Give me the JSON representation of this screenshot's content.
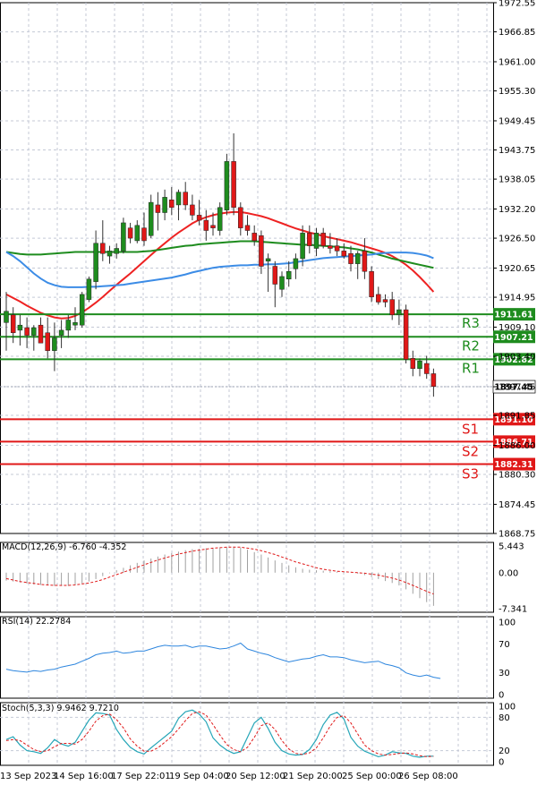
{
  "chart_data": {
    "type": "candlestick",
    "price_axis": {
      "ylim": [
        1868.75,
        1972.55
      ],
      "ticks": [
        "1972.55",
        "1966.85",
        "1961.00",
        "1955.30",
        "1949.45",
        "1943.75",
        "1938.05",
        "1932.20",
        "1926.50",
        "1920.65",
        "1914.95",
        "1909.10",
        "1903.40",
        "1897.45",
        "1891.85",
        "1886.00",
        "1880.30",
        "1874.45",
        "1868.75"
      ]
    },
    "x_labels": [
      "13 Sep 2023",
      "14 Sep 16:00",
      "17 Sep 22:01",
      "19 Sep 04:00",
      "20 Sep 12:00",
      "21 Sep 20:00",
      "25 Sep 00:00",
      "26 Sep 08:00"
    ],
    "candles": [
      {
        "o": 1910.0,
        "h": 1916.0,
        "l": 1904.5,
        "c": 1912.2
      },
      {
        "o": 1911.5,
        "h": 1913.0,
        "l": 1906.0,
        "c": 1908.0
      },
      {
        "o": 1908.5,
        "h": 1911.5,
        "l": 1905.5,
        "c": 1909.5
      },
      {
        "o": 1909.0,
        "h": 1911.0,
        "l": 1905.0,
        "c": 1907.5
      },
      {
        "o": 1907.5,
        "h": 1909.5,
        "l": 1904.5,
        "c": 1909.0
      },
      {
        "o": 1909.5,
        "h": 1911.0,
        "l": 1906.0,
        "c": 1906.0
      },
      {
        "o": 1908.0,
        "h": 1911.0,
        "l": 1903.0,
        "c": 1904.5
      },
      {
        "o": 1904.5,
        "h": 1910.0,
        "l": 1900.5,
        "c": 1907.0
      },
      {
        "o": 1907.5,
        "h": 1910.5,
        "l": 1905.0,
        "c": 1908.5
      },
      {
        "o": 1908.5,
        "h": 1911.5,
        "l": 1907.0,
        "c": 1910.5
      },
      {
        "o": 1909.5,
        "h": 1913.0,
        "l": 1908.5,
        "c": 1910.0
      },
      {
        "o": 1909.5,
        "h": 1916.0,
        "l": 1909.0,
        "c": 1915.5
      },
      {
        "o": 1914.5,
        "h": 1919.0,
        "l": 1914.0,
        "c": 1918.5
      },
      {
        "o": 1918.0,
        "h": 1928.0,
        "l": 1916.5,
        "c": 1925.5
      },
      {
        "o": 1925.5,
        "h": 1930.0,
        "l": 1922.0,
        "c": 1923.5
      },
      {
        "o": 1923.0,
        "h": 1925.0,
        "l": 1921.5,
        "c": 1924.0
      },
      {
        "o": 1923.5,
        "h": 1925.5,
        "l": 1922.5,
        "c": 1924.5
      },
      {
        "o": 1924.0,
        "h": 1930.5,
        "l": 1923.5,
        "c": 1929.5
      },
      {
        "o": 1928.5,
        "h": 1929.5,
        "l": 1925.5,
        "c": 1926.5
      },
      {
        "o": 1926.0,
        "h": 1930.0,
        "l": 1925.5,
        "c": 1929.0
      },
      {
        "o": 1928.5,
        "h": 1931.5,
        "l": 1925.0,
        "c": 1926.0
      },
      {
        "o": 1927.0,
        "h": 1935.0,
        "l": 1926.5,
        "c": 1933.5
      },
      {
        "o": 1933.0,
        "h": 1935.5,
        "l": 1928.0,
        "c": 1931.5
      },
      {
        "o": 1931.5,
        "h": 1936.0,
        "l": 1930.0,
        "c": 1934.5
      },
      {
        "o": 1934.0,
        "h": 1936.5,
        "l": 1931.0,
        "c": 1932.5
      },
      {
        "o": 1933.0,
        "h": 1936.0,
        "l": 1930.0,
        "c": 1935.5
      },
      {
        "o": 1935.5,
        "h": 1937.5,
        "l": 1932.0,
        "c": 1933.0
      },
      {
        "o": 1933.0,
        "h": 1935.0,
        "l": 1930.0,
        "c": 1931.0
      },
      {
        "o": 1931.0,
        "h": 1934.0,
        "l": 1929.0,
        "c": 1930.0
      },
      {
        "o": 1930.0,
        "h": 1932.0,
        "l": 1926.0,
        "c": 1928.0
      },
      {
        "o": 1929.0,
        "h": 1931.5,
        "l": 1927.0,
        "c": 1928.5
      },
      {
        "o": 1928.0,
        "h": 1933.5,
        "l": 1927.0,
        "c": 1932.5
      },
      {
        "o": 1932.0,
        "h": 1943.0,
        "l": 1931.0,
        "c": 1941.5
      },
      {
        "o": 1941.5,
        "h": 1947.0,
        "l": 1931.0,
        "c": 1932.5
      },
      {
        "o": 1932.5,
        "h": 1933.5,
        "l": 1927.0,
        "c": 1928.5
      },
      {
        "o": 1929.0,
        "h": 1931.0,
        "l": 1927.0,
        "c": 1928.0
      },
      {
        "o": 1927.5,
        "h": 1929.0,
        "l": 1925.0,
        "c": 1926.0
      },
      {
        "o": 1927.0,
        "h": 1928.0,
        "l": 1919.5,
        "c": 1921.0
      },
      {
        "o": 1922.0,
        "h": 1923.5,
        "l": 1916.0,
        "c": 1922.5
      },
      {
        "o": 1921.0,
        "h": 1922.0,
        "l": 1913.0,
        "c": 1917.5
      },
      {
        "o": 1916.5,
        "h": 1920.0,
        "l": 1915.0,
        "c": 1919.0
      },
      {
        "o": 1918.5,
        "h": 1922.0,
        "l": 1917.0,
        "c": 1920.0
      },
      {
        "o": 1920.5,
        "h": 1923.5,
        "l": 1918.5,
        "c": 1922.5
      },
      {
        "o": 1922.5,
        "h": 1929.0,
        "l": 1921.0,
        "c": 1927.5
      },
      {
        "o": 1927.5,
        "h": 1929.0,
        "l": 1923.5,
        "c": 1925.0
      },
      {
        "o": 1924.5,
        "h": 1928.5,
        "l": 1923.0,
        "c": 1927.5
      },
      {
        "o": 1927.5,
        "h": 1928.5,
        "l": 1924.5,
        "c": 1925.0
      },
      {
        "o": 1925.0,
        "h": 1927.5,
        "l": 1923.5,
        "c": 1924.5
      },
      {
        "o": 1925.0,
        "h": 1926.5,
        "l": 1923.0,
        "c": 1924.0
      },
      {
        "o": 1924.0,
        "h": 1925.5,
        "l": 1922.5,
        "c": 1923.0
      },
      {
        "o": 1923.5,
        "h": 1925.0,
        "l": 1920.0,
        "c": 1921.5
      },
      {
        "o": 1921.5,
        "h": 1924.0,
        "l": 1918.5,
        "c": 1923.5
      },
      {
        "o": 1924.0,
        "h": 1926.5,
        "l": 1918.5,
        "c": 1920.0
      },
      {
        "o": 1920.0,
        "h": 1921.0,
        "l": 1914.0,
        "c": 1915.0
      },
      {
        "o": 1915.5,
        "h": 1917.0,
        "l": 1913.5,
        "c": 1914.0
      },
      {
        "o": 1914.5,
        "h": 1915.5,
        "l": 1913.0,
        "c": 1914.0
      },
      {
        "o": 1914.5,
        "h": 1916.0,
        "l": 1910.5,
        "c": 1911.5
      },
      {
        "o": 1911.5,
        "h": 1914.5,
        "l": 1909.5,
        "c": 1912.5
      },
      {
        "o": 1912.5,
        "h": 1913.5,
        "l": 1902.0,
        "c": 1902.8
      },
      {
        "o": 1903.0,
        "h": 1904.5,
        "l": 1899.5,
        "c": 1901.0
      },
      {
        "o": 1901.0,
        "h": 1903.0,
        "l": 1899.5,
        "c": 1902.5
      },
      {
        "o": 1902.0,
        "h": 1903.5,
        "l": 1899.0,
        "c": 1900.0
      },
      {
        "o": 1900.0,
        "h": 1901.0,
        "l": 1895.5,
        "c": 1897.5
      }
    ],
    "series": [
      {
        "name": "",
        "color": "#ee2222",
        "values": [
          1915.5,
          1914.8,
          1914.1,
          1913.3,
          1912.6,
          1911.9,
          1911.4,
          1911.0,
          1910.8,
          1910.9,
          1911.3,
          1912.0,
          1912.9,
          1913.9,
          1915.0,
          1916.2,
          1917.4,
          1918.5,
          1919.6,
          1920.8,
          1922.0,
          1923.2,
          1924.4,
          1925.5,
          1926.6,
          1927.6,
          1928.5,
          1929.4,
          1930.1,
          1930.6,
          1931.0,
          1931.3,
          1931.5,
          1931.6,
          1931.6,
          1931.4,
          1931.1,
          1930.8,
          1930.4,
          1929.9,
          1929.4,
          1928.9,
          1928.4,
          1928.0,
          1927.6,
          1927.3,
          1926.9,
          1926.6,
          1926.3,
          1926.0,
          1925.7,
          1925.3,
          1924.9,
          1924.5,
          1924.1,
          1923.6,
          1923.0,
          1922.2,
          1921.3,
          1920.2,
          1918.9,
          1917.5,
          1916.0
        ]
      },
      {
        "name": "",
        "color": "#1e8c1e",
        "values": [
          1923.8,
          1923.6,
          1923.4,
          1923.3,
          1923.3,
          1923.3,
          1923.4,
          1923.5,
          1923.6,
          1923.7,
          1923.8,
          1923.8,
          1923.8,
          1923.8,
          1923.8,
          1923.8,
          1923.8,
          1923.8,
          1923.8,
          1923.8,
          1923.9,
          1924.0,
          1924.2,
          1924.4,
          1924.6,
          1924.8,
          1925.0,
          1925.1,
          1925.3,
          1925.4,
          1925.5,
          1925.6,
          1925.7,
          1925.8,
          1925.9,
          1925.9,
          1925.9,
          1925.8,
          1925.7,
          1925.6,
          1925.5,
          1925.4,
          1925.3,
          1925.2,
          1925.2,
          1925.1,
          1925.0,
          1924.9,
          1924.8,
          1924.7,
          1924.5,
          1924.3,
          1924.0,
          1923.7,
          1923.3,
          1922.9,
          1922.5,
          1922.2,
          1921.9,
          1921.6,
          1921.3,
          1921.0,
          1920.7
        ]
      },
      {
        "name": "",
        "color": "#3c8ce6",
        "values": [
          1923.8,
          1923.0,
          1922.0,
          1920.8,
          1919.6,
          1918.6,
          1917.8,
          1917.3,
          1917.0,
          1916.9,
          1916.9,
          1916.9,
          1917.0,
          1917.0,
          1917.1,
          1917.2,
          1917.3,
          1917.4,
          1917.6,
          1917.8,
          1918.0,
          1918.2,
          1918.4,
          1918.6,
          1918.8,
          1919.1,
          1919.4,
          1919.8,
          1920.1,
          1920.4,
          1920.7,
          1920.9,
          1921.0,
          1921.1,
          1921.2,
          1921.2,
          1921.3,
          1921.3,
          1921.4,
          1921.4,
          1921.5,
          1921.6,
          1921.8,
          1922.0,
          1922.2,
          1922.4,
          1922.6,
          1922.7,
          1922.8,
          1922.9,
          1923.0,
          1923.1,
          1923.2,
          1923.3,
          1923.5,
          1923.6,
          1923.7,
          1923.7,
          1923.7,
          1923.6,
          1923.4,
          1923.1,
          1922.6
        ]
      }
    ],
    "levels": [
      {
        "name": "R3",
        "value": 1911.61,
        "label": "1911.61",
        "color": "#1e8c1e"
      },
      {
        "name": "R2",
        "value": 1907.21,
        "label": "1907.21",
        "color": "#1e8c1e"
      },
      {
        "name": "R1",
        "value": 1902.82,
        "label": "1902.82",
        "color": "#1e8c1e"
      },
      {
        "name": "S1",
        "value": 1891.1,
        "label": "1891.10",
        "color": "#e01818"
      },
      {
        "name": "S2",
        "value": 1886.71,
        "label": "1886.71",
        "color": "#e01818"
      },
      {
        "name": "S3",
        "value": 1882.31,
        "label": "1882.31",
        "color": "#e01818"
      }
    ],
    "current_price": {
      "value": 1897.45,
      "label": "1897.45"
    },
    "macd": {
      "title": "MACD(12,26,9) -6.760 -4.352",
      "ylim": [
        -7.341,
        5.443
      ],
      "ticks": [
        "5.443",
        "0.00",
        "-7.341"
      ],
      "hist": [
        -1.6,
        -1.8,
        -2.0,
        -2.2,
        -2.4,
        -2.5,
        -2.6,
        -2.7,
        -2.7,
        -2.7,
        -2.5,
        -2.2,
        -1.8,
        -1.3,
        -0.7,
        -0.1,
        0.5,
        1.0,
        1.5,
        2.0,
        2.5,
        2.9,
        3.3,
        3.7,
        4.0,
        4.3,
        4.6,
        4.8,
        4.9,
        5.0,
        5.0,
        5.1,
        5.2,
        5.3,
        5.1,
        4.7,
        4.2,
        3.7,
        3.1,
        2.5,
        2.0,
        1.5,
        1.1,
        0.8,
        0.6,
        0.5,
        0.4,
        0.3,
        0.2,
        0.1,
        0.0,
        -0.2,
        -0.5,
        -0.9,
        -1.3,
        -1.7,
        -2.1,
        -2.6,
        -3.4,
        -4.3,
        -5.2,
        -6.0,
        -6.76
      ],
      "signal": [
        -1.2,
        -1.5,
        -1.8,
        -2.0,
        -2.2,
        -2.4,
        -2.5,
        -2.6,
        -2.6,
        -2.6,
        -2.5,
        -2.3,
        -2.1,
        -1.8,
        -1.4,
        -0.9,
        -0.4,
        0.1,
        0.6,
        1.1,
        1.6,
        2.1,
        2.6,
        3.0,
        3.4,
        3.8,
        4.1,
        4.4,
        4.6,
        4.8,
        5.0,
        5.1,
        5.2,
        5.2,
        5.2,
        5.0,
        4.8,
        4.5,
        4.1,
        3.7,
        3.2,
        2.7,
        2.2,
        1.8,
        1.4,
        1.0,
        0.7,
        0.5,
        0.3,
        0.2,
        0.1,
        0.0,
        -0.1,
        -0.3,
        -0.5,
        -0.8,
        -1.1,
        -1.5,
        -2.0,
        -2.6,
        -3.2,
        -3.8,
        -4.352
      ]
    },
    "rsi": {
      "title": "RSI(14) 22.2784",
      "ylim": [
        0,
        100
      ],
      "ticks": [
        "100",
        "70",
        "30",
        "0"
      ],
      "values": [
        35,
        33,
        32,
        31,
        33,
        32,
        34,
        35,
        38,
        40,
        42,
        46,
        50,
        55,
        57,
        58,
        60,
        57,
        58,
        60,
        60,
        63,
        66,
        68,
        67,
        67,
        68,
        65,
        67,
        67,
        65,
        63,
        64,
        67,
        71,
        63,
        60,
        57,
        55,
        51,
        48,
        45,
        47,
        49,
        50,
        53,
        55,
        52,
        52,
        51,
        48,
        46,
        44,
        45,
        46,
        42,
        40,
        37,
        30,
        27,
        25,
        27,
        24,
        22.28
      ]
    },
    "stoch": {
      "title": "Stoch(5,3,3) 9.9462 9.7210",
      "ylim": [
        0,
        100
      ],
      "ticks": [
        "100",
        "80",
        "20",
        "0"
      ],
      "k": [
        40,
        45,
        30,
        20,
        18,
        15,
        25,
        40,
        32,
        28,
        35,
        55,
        75,
        88,
        87,
        84,
        58,
        40,
        26,
        18,
        14,
        25,
        35,
        45,
        55,
        78,
        90,
        93,
        86,
        72,
        43,
        30,
        21,
        15,
        18,
        44,
        70,
        80,
        60,
        35,
        20,
        14,
        12,
        13,
        22,
        40,
        67,
        84,
        89,
        77,
        44,
        28,
        19,
        14,
        9,
        12,
        18,
        16,
        15,
        10,
        8,
        10,
        9.95
      ],
      "d": [
        38,
        40,
        38,
        30,
        22,
        18,
        20,
        27,
        33,
        33,
        32,
        40,
        55,
        73,
        83,
        86,
        76,
        61,
        41,
        28,
        19,
        19,
        25,
        35,
        45,
        59,
        74,
        87,
        90,
        84,
        67,
        48,
        31,
        22,
        18,
        26,
        44,
        65,
        70,
        58,
        38,
        23,
        15,
        13,
        16,
        25,
        43,
        64,
        80,
        83,
        70,
        50,
        30,
        20,
        14,
        12,
        13,
        15,
        16,
        14,
        11,
        9,
        9.72
      ]
    }
  }
}
